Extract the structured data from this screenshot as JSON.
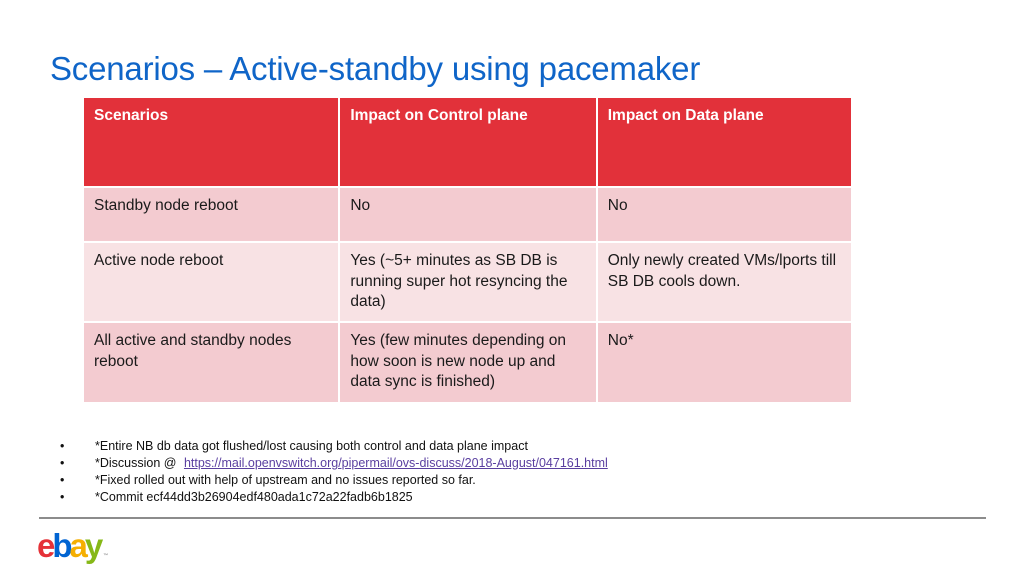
{
  "slide": {
    "title": "Scenarios – Active-standby using pacemaker"
  },
  "table": {
    "headers": [
      "Scenarios",
      "Impact on Control plane",
      "Impact on Data plane"
    ],
    "rows": [
      [
        "Standby node reboot",
        "No",
        "No"
      ],
      [
        "Active node reboot",
        "Yes (~5+ minutes as SB DB is running super hot resyncing the data)",
        "Only newly created VMs/lports till SB DB cools down."
      ],
      [
        "All active and standby nodes reboot",
        "Yes (few minutes depending on how soon is new node up and data sync is finished)",
        "No*"
      ]
    ],
    "colors": {
      "header_bg": "#e2313a",
      "row_dark": "#f3cbd0",
      "row_light": "#f8e2e4"
    }
  },
  "notes": {
    "bullet": "•",
    "items": [
      {
        "text": "*Entire NB db data got flushed/lost causing both control and data plane impact"
      },
      {
        "text": "*Discussion @",
        "link": "https://mail.openvswitch.org/pipermail/ovs-discuss/2018-August/047161.html"
      },
      {
        "text": "*Fixed rolled out with help of upstream and no issues reported so far."
      },
      {
        "text": "*Commit ecf44dd3b26904edf480ada1c72a22fadb6b1825"
      }
    ]
  },
  "footer": {
    "logo": {
      "letters": [
        "e",
        "b",
        "a",
        "y"
      ],
      "colors": [
        "#e53238",
        "#0064d2",
        "#f5af02",
        "#86b817"
      ],
      "tm": "™"
    }
  }
}
